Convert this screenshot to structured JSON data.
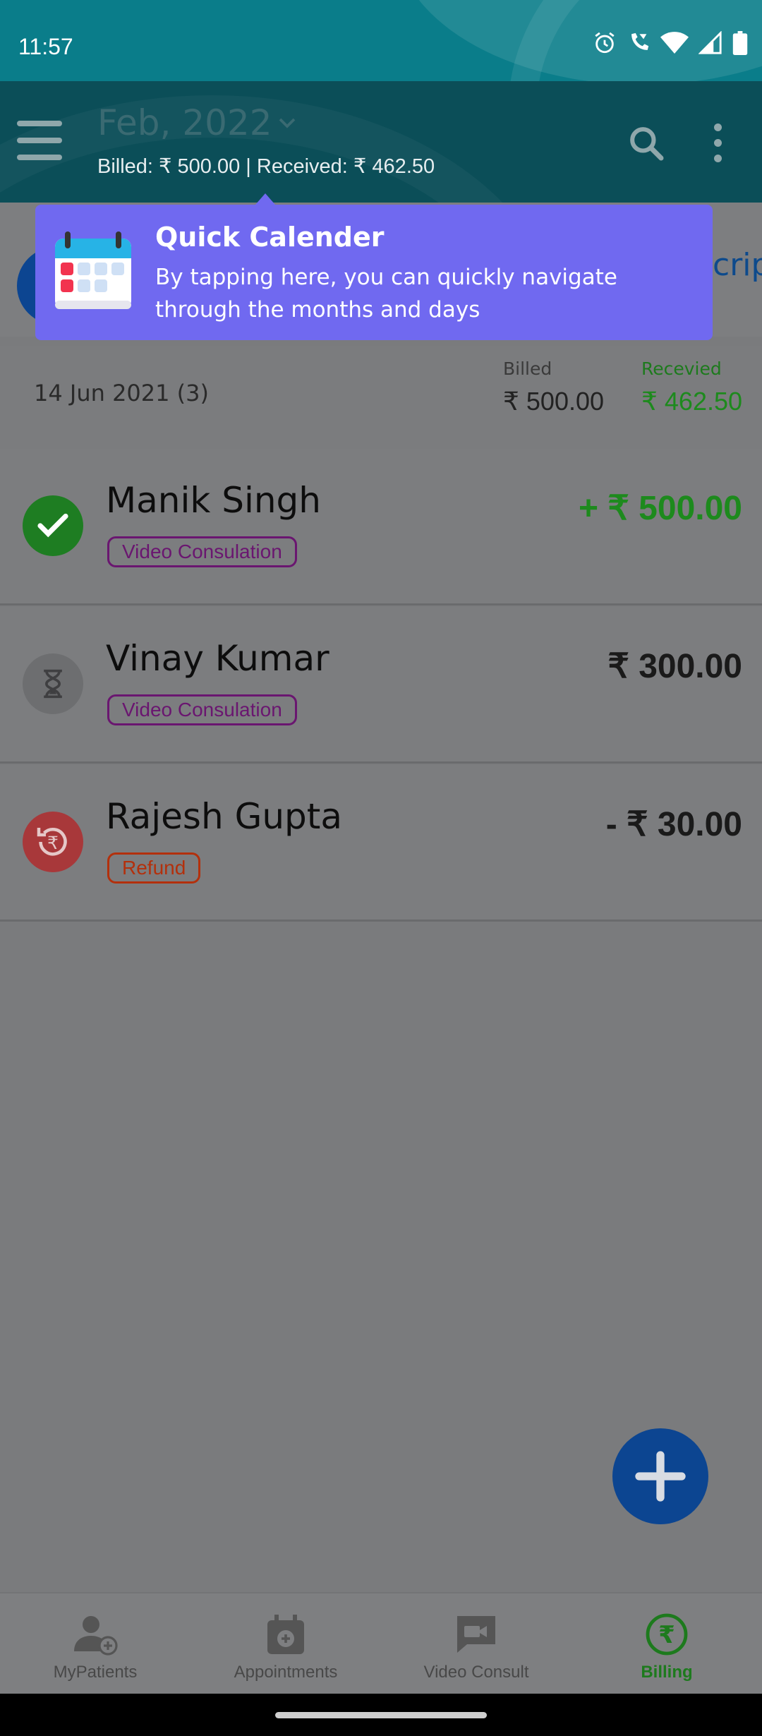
{
  "status_bar": {
    "time": "11:57"
  },
  "app_bar": {
    "month": "Feb, 2022",
    "billed_label": "Billed: ₹ 500.00",
    "received_label": "Received: ₹ 462.50"
  },
  "filter": {
    "partial_text": "crip"
  },
  "tooltip": {
    "title": "Quick Calender",
    "body": "By tapping here, you can quickly navigate through the months and days"
  },
  "day_group": {
    "date": "14 Jun 2021 (3)",
    "billed_label": "Billed",
    "billed_value": "₹ 500.00",
    "received_label": "Recevied",
    "received_value": "₹ 462.50"
  },
  "transactions": [
    {
      "name": "Manik Singh",
      "tag": "Video Consulation",
      "amount": "+ ₹ 500.00",
      "status": "completed-icon",
      "amount_color": "#1d8a1d",
      "tag_color": "#6a1670"
    },
    {
      "name": "Vinay Kumar",
      "tag": "Video Consulation",
      "amount": "₹ 300.00",
      "status": "hourglass-icon",
      "amount_color": "#1a1a1a",
      "tag_color": "#6a1670"
    },
    {
      "name": "Rajesh Gupta",
      "tag": "Refund",
      "amount": "- ₹ 30.00",
      "status": "refund-icon",
      "amount_color": "#1a1a1a",
      "tag_color": "#b3300c"
    }
  ],
  "bottom_nav": {
    "items": [
      {
        "label": "MyPatients",
        "icon": "patients-icon"
      },
      {
        "label": "Appointments",
        "icon": "calendar-icon"
      },
      {
        "label": "Video Consult",
        "icon": "video-consult-icon"
      },
      {
        "label": "Billing",
        "icon": "rupee-icon",
        "active": true
      }
    ]
  },
  "colors": {
    "status_bar": "#0a7d8a",
    "app_bar": "#0b4e58",
    "tooltip": "#7069f0",
    "fab": "#0c4591",
    "active_nav": "#1d8a1d"
  }
}
